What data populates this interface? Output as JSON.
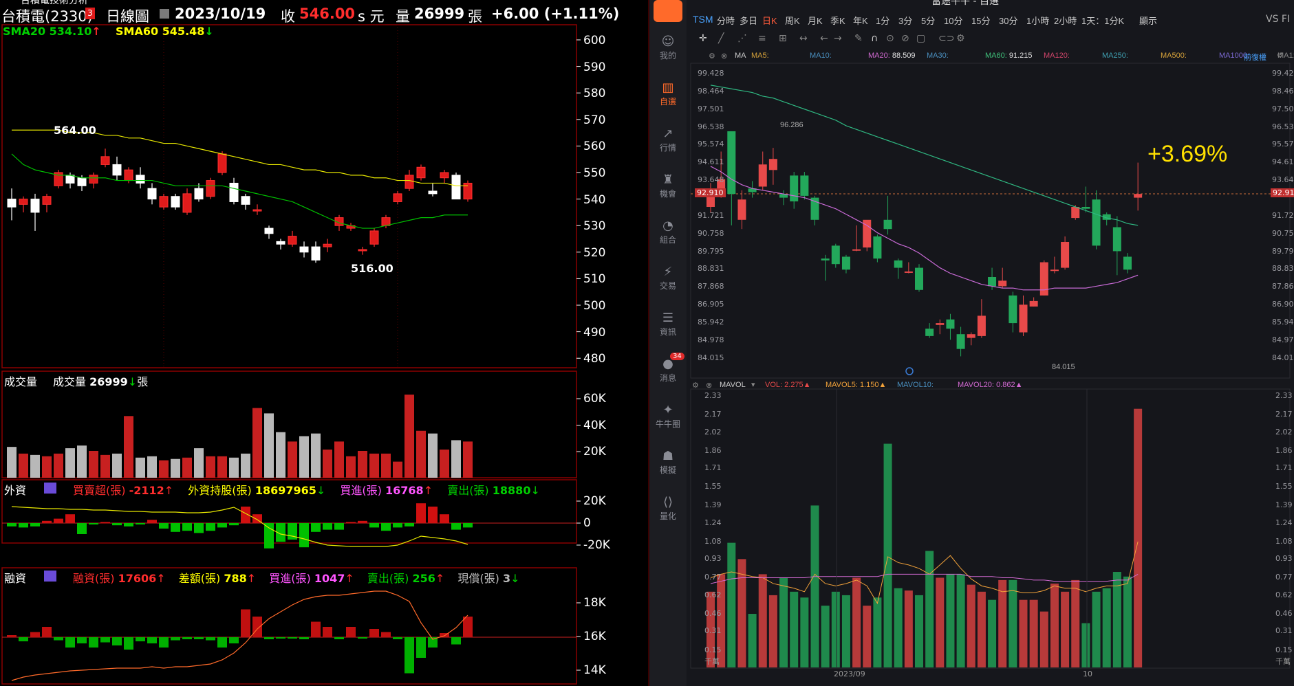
{
  "left": {
    "title_fragment": "台積電技術分析",
    "stock_name": "台積電(2330)",
    "badge": "3",
    "period": "日線圖",
    "date": "2023/10/19",
    "close_label": "收",
    "close_value": "546.00",
    "close_suffix": "s 元",
    "volume_label": "量",
    "volume_value": "26999",
    "volume_unit": "張",
    "change": "+6.00 (+1.11%)",
    "sma20": "SMA20 534.10",
    "sma60": "SMA60 545.48",
    "high_label": "564.00",
    "low_label": "516.00",
    "price_axis": [
      "600",
      "590",
      "580",
      "570",
      "560",
      "550",
      "540",
      "530",
      "520",
      "510",
      "500",
      "490",
      "480"
    ],
    "vol_title": "成交量",
    "vol_sub": "成交量",
    "vol_value": "26999",
    "vol_unit": "張",
    "vol_axis": [
      "60K",
      "40K",
      "20K"
    ],
    "foreign": {
      "title": "外資",
      "net_label": "買賣超(張)",
      "net_value": "-2112",
      "hold_label": "外資持股(張)",
      "hold_value": "18697965",
      "buy_label": "買進(張)",
      "buy_value": "16768",
      "sell_label": "賣出(張)",
      "sell_value": "18880",
      "axis": [
        "20K",
        "0",
        "-20K"
      ]
    },
    "margin": {
      "title": "融資",
      "bal_label": "融資(張)",
      "bal_value": "17606",
      "diff_label": "差額(張)",
      "diff_value": "788",
      "buy_label": "買進(張)",
      "buy_value": "1047",
      "sell_label": "賣出(張)",
      "sell_value": "256",
      "repay_label": "現償(張)",
      "repay_value": "3",
      "axis": [
        "18K",
        "16K",
        "14K"
      ]
    }
  },
  "right": {
    "window_title": "富途牛牛 - 自選",
    "sidebar": [
      {
        "label": "我的"
      },
      {
        "label": "自選"
      },
      {
        "label": "行情"
      },
      {
        "label": "機會"
      },
      {
        "label": "組合"
      },
      {
        "label": "交易"
      },
      {
        "label": "資訊"
      },
      {
        "label": "消息",
        "badge": "34"
      },
      {
        "label": "牛牛圈"
      },
      {
        "label": "模擬"
      },
      {
        "label": "量化"
      }
    ],
    "symbol": "TSM",
    "timeframes": [
      "分時",
      "多日",
      "日K",
      "周K",
      "月K",
      "季K",
      "年K",
      "1分",
      "3分",
      "5分",
      "10分",
      "15分",
      "30分",
      "1小時",
      "2小時",
      "1天：1分K",
      "顯示"
    ],
    "active_timeframe": "日K",
    "vs_label": "VS FI",
    "ma_bar": {
      "ma": "MA",
      "items": [
        {
          "label": "MA5:",
          "value": ""
        },
        {
          "label": "MA10:",
          "value": ""
        },
        {
          "label": "MA20:",
          "value": "88.509"
        },
        {
          "label": "MA30:",
          "value": ""
        },
        {
          "label": "MA60:",
          "value": "91.215"
        },
        {
          "label": "MA120:",
          "value": ""
        },
        {
          "label": "MA250:",
          "value": ""
        },
        {
          "label": "MA500:",
          "value": ""
        },
        {
          "label": "MA1000:",
          "value": ""
        },
        {
          "label": "MA1:",
          "value": ""
        }
      ],
      "adjust": "前復權"
    },
    "price_axis": [
      "99.428",
      "98.464",
      "97.501",
      "96.538",
      "95.574",
      "94.611",
      "93.648",
      "92.910",
      "91.721",
      "90.758",
      "89.795",
      "88.831",
      "87.868",
      "86.905",
      "85.942",
      "84.978",
      "84.015"
    ],
    "current_price": "92.910",
    "high_label": "96.286",
    "low_label": "84.015",
    "change_pct": "+3.69%",
    "vol_bar": {
      "title": "MAVOL",
      "vol_label": "VOL:",
      "vol_value": "2.275",
      "mavol5_label": "MAVOL5:",
      "mavol5_value": "1.150",
      "mavol10_label": "MAVOL10:",
      "mavol20_label": "MAVOL20:",
      "mavol20_value": "0.862"
    },
    "vol_axis": [
      "2.33",
      "2.17",
      "2.02",
      "1.86",
      "1.71",
      "1.55",
      "1.39",
      "1.24",
      "1.08",
      "0.93",
      "0.77",
      "0.62",
      "0.46",
      "0.31",
      "0.15"
    ],
    "vol_unit": "千萬",
    "x_labels": [
      "2023/09",
      "10"
    ]
  },
  "colors": {
    "up_red": "#ff2d2d",
    "down_green": "#00d000",
    "yellow": "#ffff00",
    "magenta": "#ff55ff",
    "futu_up": "#e84a4a",
    "futu_down": "#23a85b"
  }
}
